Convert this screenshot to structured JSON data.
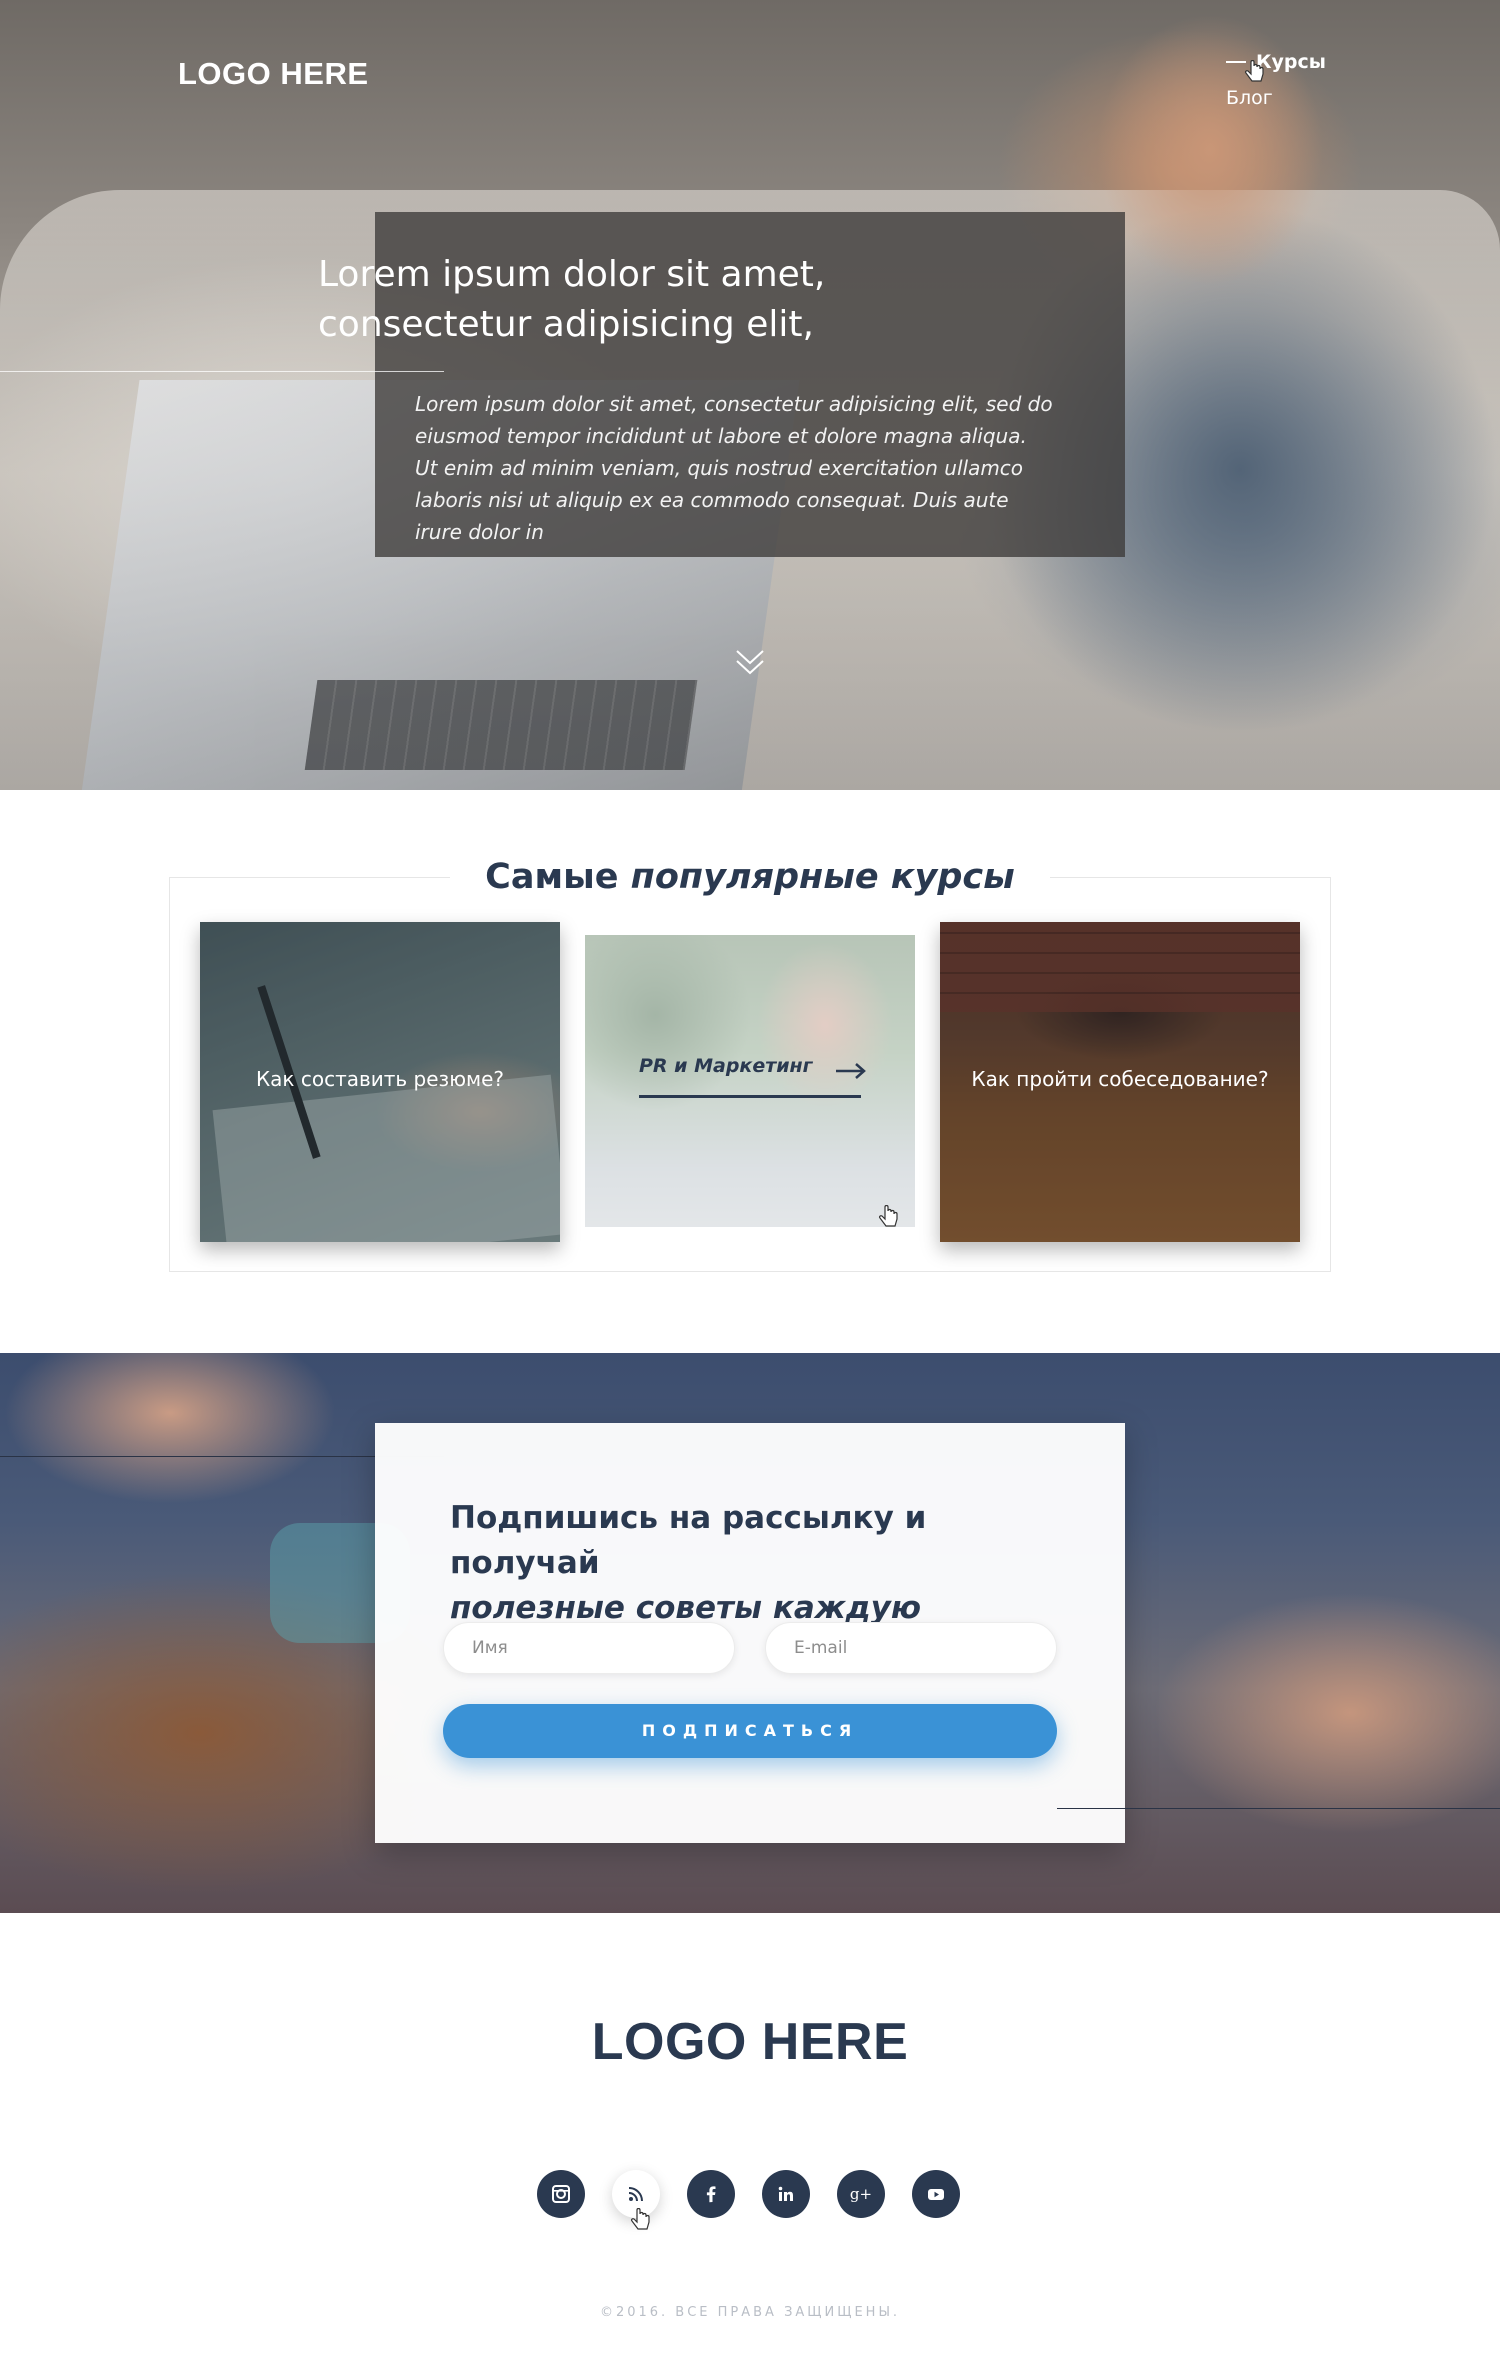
{
  "header": {
    "logo": "LOGO HERE",
    "nav": [
      {
        "label": "Курсы",
        "active": true
      },
      {
        "label": "Блог",
        "active": false
      }
    ]
  },
  "hero": {
    "title_line1": "Lorem ipsum dolor sit amet,",
    "title_line2": "consectetur adipisicing elit,",
    "text": "Lorem ipsum dolor sit amet, consectetur adipisicing elit, sed do eiusmod tempor incididunt ut labore et dolore magna aliqua. Ut enim ad minim veniam, quis nostrud exercitation ullamco laboris nisi ut aliquip ex ea commodo consequat. Duis aute irure dolor in",
    "scroll_icon": "chevron-double-down-icon"
  },
  "courses": {
    "title_regular": "Самые ",
    "title_bold": "популярные курсы",
    "cards": [
      {
        "label": "Как составить резюме?"
      },
      {
        "label": "PR и Маркетинг"
      },
      {
        "label": "Как пройти собеседование?"
      }
    ]
  },
  "subscribe": {
    "title_line1": "Подпишись на рассылку и получай",
    "title_line2": "полезные советы каждую неделю!",
    "name_placeholder": "Имя",
    "email_placeholder": "E-mail",
    "button": "ПОДПИСАТЬСЯ",
    "button_color": "#3a92d6"
  },
  "footer": {
    "logo": "LOGO HERE",
    "socials": [
      "instagram-icon",
      "rss-icon",
      "facebook-icon",
      "linkedin-icon",
      "google-plus-icon",
      "youtube-icon"
    ],
    "copyright": "©2016. ВСЕ ПРАВА ЗАЩИЩЕНЫ."
  },
  "colors": {
    "brand_dark": "#2a3950",
    "accent": "#3a92d6"
  }
}
